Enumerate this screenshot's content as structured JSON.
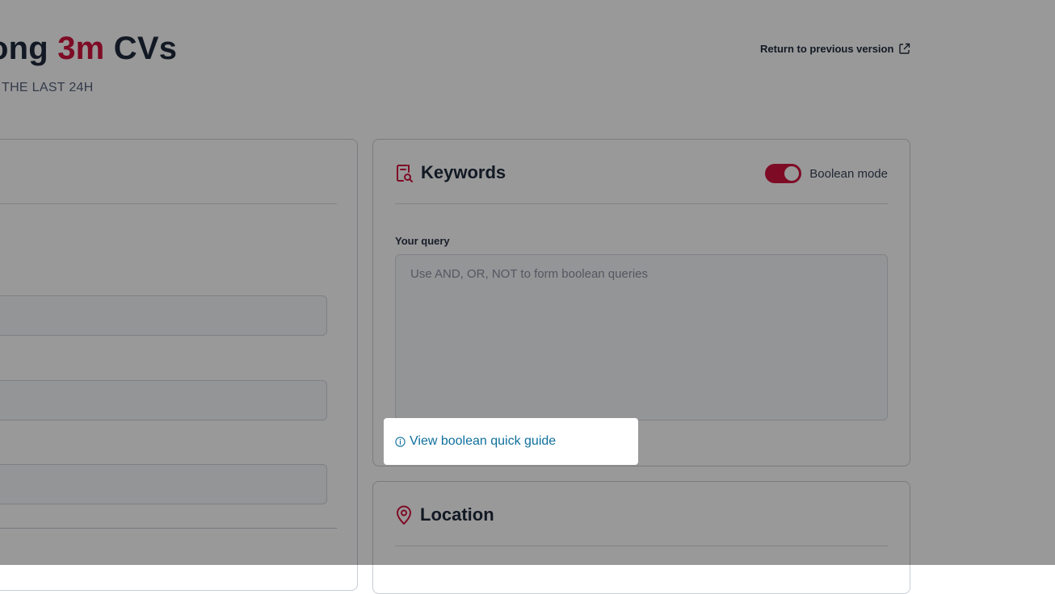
{
  "header": {
    "title_prefix": "ong ",
    "title_highlight": "3m",
    "title_suffix": " CVs",
    "subtitle": "THE LAST 24H",
    "return_link": "Return to previous version"
  },
  "keywords": {
    "title": "Keywords",
    "boolean_mode_label": "Boolean mode",
    "boolean_mode_on": true,
    "query_label": "Your query",
    "query_value": "",
    "query_placeholder": "Use AND, OR, NOT to form boolean queries",
    "guide_link": "View boolean quick guide"
  },
  "location": {
    "title": "Location"
  },
  "colors": {
    "accent": "#d3133f",
    "link": "#0e6f9d",
    "text": "#1f2a3c"
  },
  "icons": {
    "return": "external-link-icon",
    "keywords": "document-search-icon",
    "location": "map-pin-icon",
    "guide": "info-circle-icon"
  }
}
